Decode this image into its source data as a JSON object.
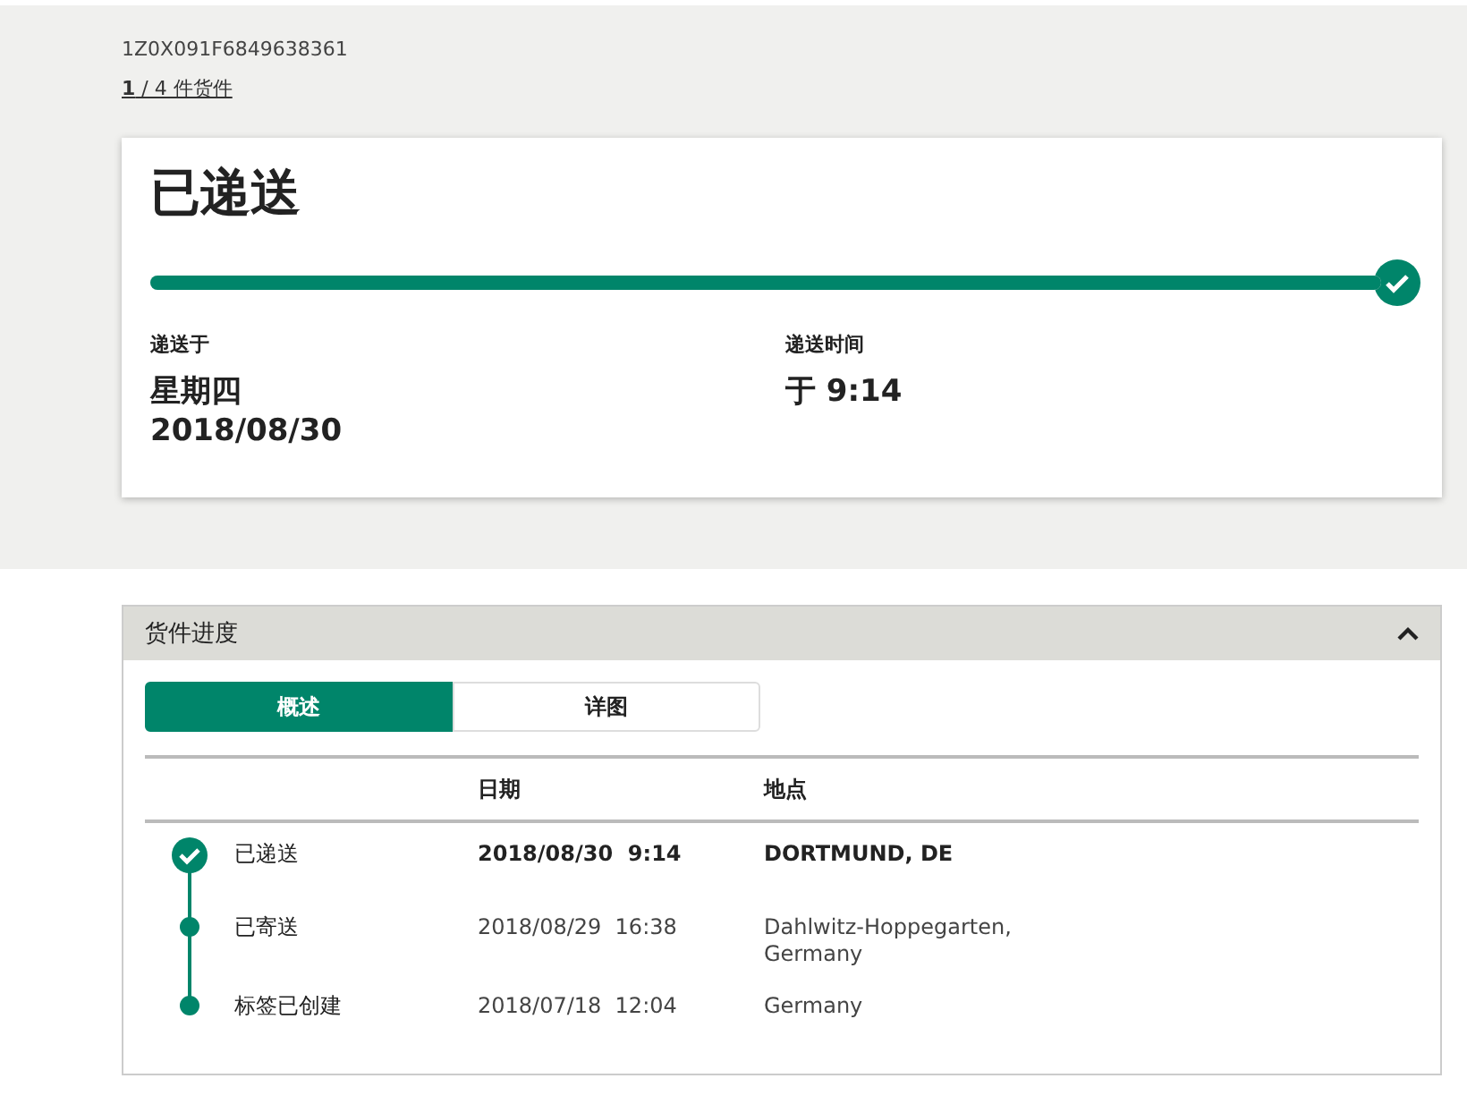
{
  "tracking_number": "1Z0X091F6849638361",
  "shipment_counter": "**1** / 4 件货件",
  "status_card": {
    "title": "已递送",
    "progress": {
      "level": 1,
      "complete": true
    },
    "fields": [
      {
        "label": "递送于",
        "lines": [
          "星期四",
          "2018/08/30"
        ]
      },
      {
        "label": "递送时间",
        "lines": [
          "于 9:14"
        ]
      }
    ]
  },
  "progress_panel": {
    "title": "货件进度",
    "expanded": true,
    "tabs": [
      {
        "label": "概述",
        "selected": true
      },
      {
        "label": "详图",
        "selected": false
      }
    ],
    "table": {
      "columns": [
        "日期",
        "地点"
      ],
      "rows": [
        {
          "kind": "delivered",
          "status": "已递送",
          "date": "2018/08/30  9:14",
          "location": [
            "DORTMUND, DE"
          ]
        },
        {
          "kind": "step",
          "status": "已寄送",
          "date": "2018/08/29  16:38",
          "location": [
            "Dahlwitz-Hoppegarten,",
            "Germany"
          ]
        },
        {
          "kind": "step",
          "status": "标签已创建",
          "date": "2018/07/18  12:04",
          "location": [
            "Germany"
          ]
        }
      ]
    }
  }
}
